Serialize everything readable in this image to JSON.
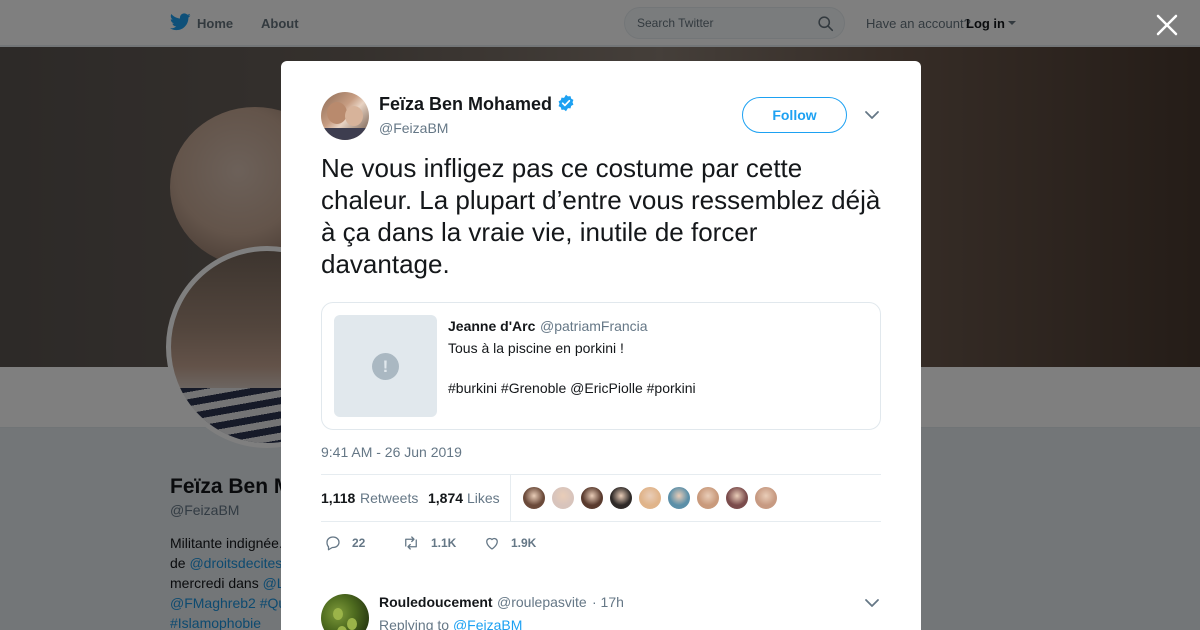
{
  "nav": {
    "home_label": "Home",
    "about_label": "About",
    "search_placeholder": "Search Twitter",
    "have_account": "Have an account?",
    "login_label": "Log in"
  },
  "background_profile": {
    "name_partial": "Feïza Ben M",
    "handle": "@FeizaBM",
    "bio_lines": [
      {
        "text": "Militante indignée.",
        "link": ""
      },
      {
        "text": "de ",
        "link": "@droitsdecites"
      },
      {
        "text": "mercredi dans ",
        "link": "@L"
      },
      {
        "text": "",
        "link": "@FMaghreb2 #Qu"
      },
      {
        "text": "",
        "link": "#Islamophobie"
      }
    ]
  },
  "tweet": {
    "author_name": "Feïza Ben Mohamed",
    "author_handle": "@FeizaBM",
    "verified": true,
    "follow_label": "Follow",
    "text": "Ne vous infligez pas ce costume par cette chaleur. La plupart d’entre vous ressemblez déjà à ça dans la vraie vie, inutile de forcer davantage.",
    "quoted": {
      "name": "Jeanne d'Arc",
      "handle": "@patriamFrancia",
      "line1": "Tous à la piscine en porkini !",
      "line2": "#burkini #Grenoble @EricPiolle #porkini",
      "media_warning_glyph": "!"
    },
    "timestamp": "9:41 AM - 26 Jun 2019",
    "retweets_count": "1,118",
    "retweets_label": "Retweets",
    "likes_count": "1,874",
    "likes_label": "Likes",
    "liker_avatar_colors": [
      "#6b4a3a",
      "#d8c4bc",
      "#5a3b2e",
      "#2f2a28",
      "#e0b48a",
      "#5b8fa8",
      "#c99a7c",
      "#7b4c4c",
      "#c79a82"
    ],
    "actions": {
      "reply_count": "22",
      "retweet_count": "1.1K",
      "like_count": "1.9K"
    }
  },
  "reply": {
    "name": "Rouledoucement",
    "handle": "@roulepasvite",
    "time": "· 17h",
    "replying_to_label": "Replying to",
    "replying_to_handle": "@FeizaBM"
  },
  "colors": {
    "accent": "#1da1f2",
    "verified": "#1da1f2",
    "overlay": "rgba(0,0,0,0.5)",
    "muted": "#657786"
  }
}
